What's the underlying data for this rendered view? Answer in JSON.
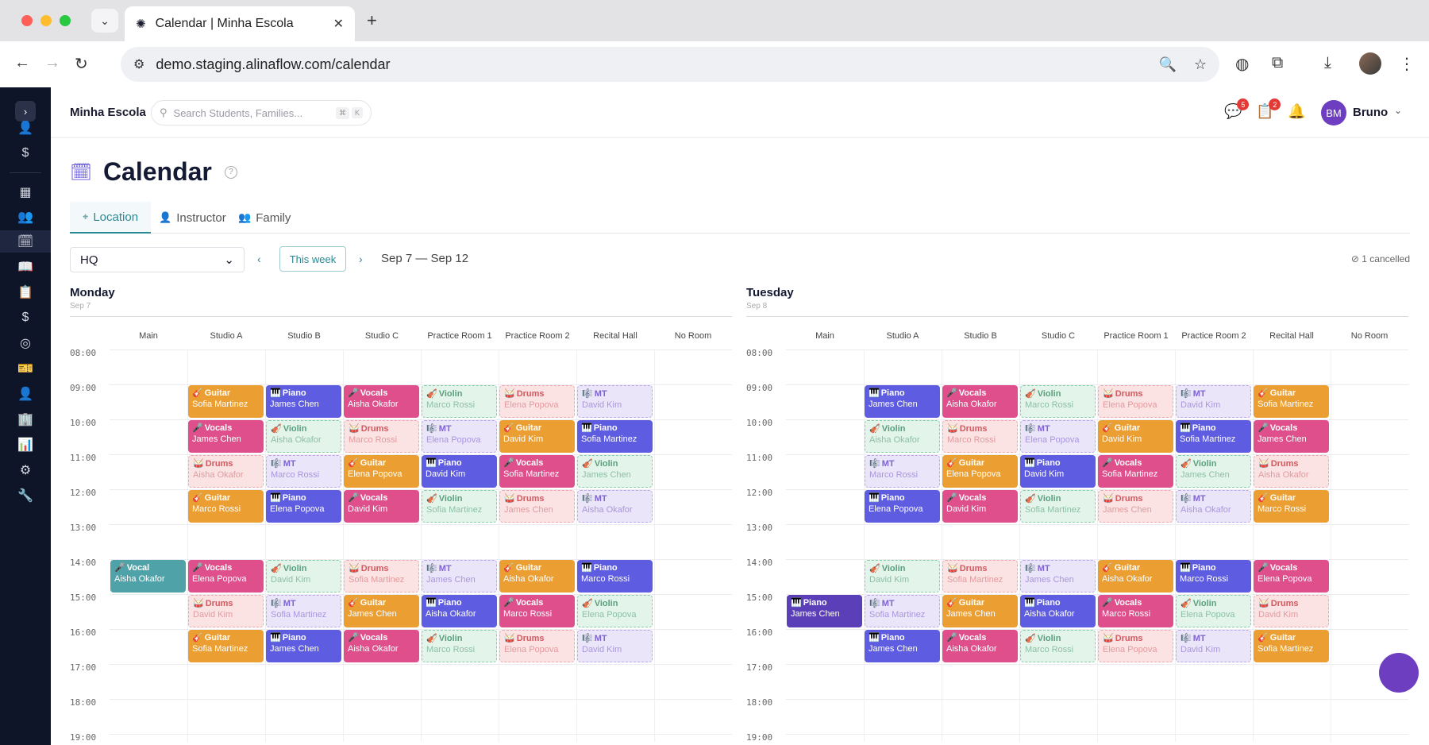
{
  "browser": {
    "tab_title": "Calendar | Minha Escola",
    "url": "demo.staging.alinaflow.com/calendar"
  },
  "header": {
    "school": "Minha Escola",
    "search_placeholder": "Search Students, Families...",
    "kbd1": "⌘",
    "kbd2": "K",
    "messages_badge": "5",
    "tasks_badge": "2",
    "user_initials": "BM",
    "user_name": "Bruno"
  },
  "page": {
    "title": "Calendar",
    "tabs": [
      "Location",
      "Instructor",
      "Family"
    ],
    "location": "HQ",
    "this_week": "This week",
    "range": "Sep 7 — Sep 12",
    "cancelled": "1 cancelled"
  },
  "colors": {
    "accent": "#2a8a93",
    "sidebar": "#0e1528",
    "brand": "#6d3fc0"
  },
  "rooms": [
    "Main",
    "Studio A",
    "Studio B",
    "Studio C",
    "Practice Room 1",
    "Practice Room 2",
    "Recital Hall",
    "No Room"
  ],
  "times": [
    "08:00",
    "09:00",
    "10:00",
    "11:00",
    "12:00",
    "13:00",
    "14:00",
    "15:00",
    "16:00",
    "17:00",
    "18:00",
    "19:00"
  ],
  "days": [
    {
      "name": "Monday",
      "date": "Sep 7",
      "events": [
        {
          "room": 1,
          "slot": 1,
          "title": "Guitar",
          "who": "Sofia Martinez",
          "kind": "guitar",
          "icon": "🎸"
        },
        {
          "room": 2,
          "slot": 1,
          "title": "Piano",
          "who": "James Chen",
          "kind": "piano",
          "icon": "🎹"
        },
        {
          "room": 3,
          "slot": 1,
          "title": "Vocals",
          "who": "Aisha Okafor",
          "kind": "vocals",
          "icon": "🎤"
        },
        {
          "room": 4,
          "slot": 1,
          "title": "Violin",
          "who": "Marco Rossi",
          "kind": "violin",
          "icon": "🎻"
        },
        {
          "room": 5,
          "slot": 1,
          "title": "Drums",
          "who": "Elena Popova",
          "kind": "drums",
          "icon": "🥁"
        },
        {
          "room": 6,
          "slot": 1,
          "title": "MT",
          "who": "David Kim",
          "kind": "mt",
          "icon": "🎼"
        },
        {
          "room": 1,
          "slot": 2,
          "title": "Vocals",
          "who": "James Chen",
          "kind": "vocals",
          "icon": "🎤"
        },
        {
          "room": 2,
          "slot": 2,
          "title": "Violin",
          "who": "Aisha Okafor",
          "kind": "violin",
          "icon": "🎻"
        },
        {
          "room": 3,
          "slot": 2,
          "title": "Drums",
          "who": "Marco Rossi",
          "kind": "drums",
          "icon": "🥁"
        },
        {
          "room": 4,
          "slot": 2,
          "title": "MT",
          "who": "Elena Popova",
          "kind": "mt",
          "icon": "🎼"
        },
        {
          "room": 5,
          "slot": 2,
          "title": "Guitar",
          "who": "David Kim",
          "kind": "guitar",
          "icon": "🎸"
        },
        {
          "room": 6,
          "slot": 2,
          "title": "Piano",
          "who": "Sofia Martinez",
          "kind": "piano",
          "icon": "🎹"
        },
        {
          "room": 1,
          "slot": 3,
          "title": "Drums",
          "who": "Aisha Okafor",
          "kind": "drums",
          "icon": "🥁"
        },
        {
          "room": 2,
          "slot": 3,
          "title": "MT",
          "who": "Marco Rossi",
          "kind": "mt",
          "icon": "🎼"
        },
        {
          "room": 3,
          "slot": 3,
          "title": "Guitar",
          "who": "Elena Popova",
          "kind": "guitar",
          "icon": "🎸"
        },
        {
          "room": 4,
          "slot": 3,
          "title": "Piano",
          "who": "David Kim",
          "kind": "piano",
          "icon": "🎹"
        },
        {
          "room": 5,
          "slot": 3,
          "title": "Vocals",
          "who": "Sofia Martinez",
          "kind": "vocals",
          "icon": "🎤"
        },
        {
          "room": 6,
          "slot": 3,
          "title": "Violin",
          "who": "James Chen",
          "kind": "violin",
          "icon": "🎻"
        },
        {
          "room": 1,
          "slot": 4,
          "title": "Guitar",
          "who": "Marco Rossi",
          "kind": "guitar",
          "icon": "🎸"
        },
        {
          "room": 2,
          "slot": 4,
          "title": "Piano",
          "who": "Elena Popova",
          "kind": "piano",
          "icon": "🎹"
        },
        {
          "room": 3,
          "slot": 4,
          "title": "Vocals",
          "who": "David Kim",
          "kind": "vocals",
          "icon": "🎤"
        },
        {
          "room": 4,
          "slot": 4,
          "title": "Violin",
          "who": "Sofia Martinez",
          "kind": "violin",
          "icon": "🎻"
        },
        {
          "room": 5,
          "slot": 4,
          "title": "Drums",
          "who": "James Chen",
          "kind": "drums",
          "icon": "🥁"
        },
        {
          "room": 6,
          "slot": 4,
          "title": "MT",
          "who": "Aisha Okafor",
          "kind": "mt",
          "icon": "🎼"
        },
        {
          "room": 0,
          "slot": 6,
          "title": "Vocal",
          "who": "Aisha Okafor",
          "kind": "vocal",
          "icon": "🎤"
        },
        {
          "room": 1,
          "slot": 6,
          "title": "Vocals",
          "who": "Elena Popova",
          "kind": "vocals",
          "icon": "🎤"
        },
        {
          "room": 2,
          "slot": 6,
          "title": "Violin",
          "who": "David Kim",
          "kind": "violin",
          "icon": "🎻"
        },
        {
          "room": 3,
          "slot": 6,
          "title": "Drums",
          "who": "Sofia Martinez",
          "kind": "drums",
          "icon": "🥁"
        },
        {
          "room": 4,
          "slot": 6,
          "title": "MT",
          "who": "James Chen",
          "kind": "mt",
          "icon": "🎼"
        },
        {
          "room": 5,
          "slot": 6,
          "title": "Guitar",
          "who": "Aisha Okafor",
          "kind": "guitar",
          "icon": "🎸"
        },
        {
          "room": 6,
          "slot": 6,
          "title": "Piano",
          "who": "Marco Rossi",
          "kind": "piano",
          "icon": "🎹"
        },
        {
          "room": 1,
          "slot": 7,
          "title": "Drums",
          "who": "David Kim",
          "kind": "drums",
          "icon": "🥁"
        },
        {
          "room": 2,
          "slot": 7,
          "title": "MT",
          "who": "Sofia Martinez",
          "kind": "mt",
          "icon": "🎼"
        },
        {
          "room": 3,
          "slot": 7,
          "title": "Guitar",
          "who": "James Chen",
          "kind": "guitar",
          "icon": "🎸"
        },
        {
          "room": 4,
          "slot": 7,
          "title": "Piano",
          "who": "Aisha Okafor",
          "kind": "piano",
          "icon": "🎹"
        },
        {
          "room": 5,
          "slot": 7,
          "title": "Vocals",
          "who": "Marco Rossi",
          "kind": "vocals",
          "icon": "🎤"
        },
        {
          "room": 6,
          "slot": 7,
          "title": "Violin",
          "who": "Elena Popova",
          "kind": "violin",
          "icon": "🎻"
        },
        {
          "room": 1,
          "slot": 8,
          "title": "Guitar",
          "who": "Sofia Martinez",
          "kind": "guitar",
          "icon": "🎸"
        },
        {
          "room": 2,
          "slot": 8,
          "title": "Piano",
          "who": "James Chen",
          "kind": "piano",
          "icon": "🎹"
        },
        {
          "room": 3,
          "slot": 8,
          "title": "Vocals",
          "who": "Aisha Okafor",
          "kind": "vocals",
          "icon": "🎤"
        },
        {
          "room": 4,
          "slot": 8,
          "title": "Violin",
          "who": "Marco Rossi",
          "kind": "violin",
          "icon": "🎻"
        },
        {
          "room": 5,
          "slot": 8,
          "title": "Drums",
          "who": "Elena Popova",
          "kind": "drums",
          "icon": "🥁"
        },
        {
          "room": 6,
          "slot": 8,
          "title": "MT",
          "who": "David Kim",
          "kind": "mt",
          "icon": "🎼"
        }
      ]
    },
    {
      "name": "Tuesday",
      "date": "Sep 8",
      "events": [
        {
          "room": 1,
          "slot": 1,
          "title": "Piano",
          "who": "James Chen",
          "kind": "piano",
          "icon": "🎹"
        },
        {
          "room": 2,
          "slot": 1,
          "title": "Vocals",
          "who": "Aisha Okafor",
          "kind": "vocals",
          "icon": "🎤"
        },
        {
          "room": 3,
          "slot": 1,
          "title": "Violin",
          "who": "Marco Rossi",
          "kind": "violin",
          "icon": "🎻"
        },
        {
          "room": 4,
          "slot": 1,
          "title": "Drums",
          "who": "Elena Popova",
          "kind": "drums",
          "icon": "🥁"
        },
        {
          "room": 5,
          "slot": 1,
          "title": "MT",
          "who": "David Kim",
          "kind": "mt",
          "icon": "🎼"
        },
        {
          "room": 6,
          "slot": 1,
          "title": "Guitar",
          "who": "Sofia Martinez",
          "kind": "guitar",
          "icon": "🎸"
        },
        {
          "room": 1,
          "slot": 2,
          "title": "Violin",
          "who": "Aisha Okafor",
          "kind": "violin",
          "icon": "🎻"
        },
        {
          "room": 2,
          "slot": 2,
          "title": "Drums",
          "who": "Marco Rossi",
          "kind": "drums",
          "icon": "🥁"
        },
        {
          "room": 3,
          "slot": 2,
          "title": "MT",
          "who": "Elena Popova",
          "kind": "mt",
          "icon": "🎼"
        },
        {
          "room": 4,
          "slot": 2,
          "title": "Guitar",
          "who": "David Kim",
          "kind": "guitar",
          "icon": "🎸"
        },
        {
          "room": 5,
          "slot": 2,
          "title": "Piano",
          "who": "Sofia Martinez",
          "kind": "piano",
          "icon": "🎹"
        },
        {
          "room": 6,
          "slot": 2,
          "title": "Vocals",
          "who": "James Chen",
          "kind": "vocals",
          "icon": "🎤"
        },
        {
          "room": 1,
          "slot": 3,
          "title": "MT",
          "who": "Marco Rossi",
          "kind": "mt",
          "icon": "🎼"
        },
        {
          "room": 2,
          "slot": 3,
          "title": "Guitar",
          "who": "Elena Popova",
          "kind": "guitar",
          "icon": "🎸"
        },
        {
          "room": 3,
          "slot": 3,
          "title": "Piano",
          "who": "David Kim",
          "kind": "piano",
          "icon": "🎹"
        },
        {
          "room": 4,
          "slot": 3,
          "title": "Vocals",
          "who": "Sofia Martinez",
          "kind": "vocals",
          "icon": "🎤"
        },
        {
          "room": 5,
          "slot": 3,
          "title": "Violin",
          "who": "James Chen",
          "kind": "violin",
          "icon": "🎻"
        },
        {
          "room": 6,
          "slot": 3,
          "title": "Drums",
          "who": "Aisha Okafor",
          "kind": "drums",
          "icon": "🥁"
        },
        {
          "room": 1,
          "slot": 4,
          "title": "Piano",
          "who": "Elena Popova",
          "kind": "piano",
          "icon": "🎹"
        },
        {
          "room": 2,
          "slot": 4,
          "title": "Vocals",
          "who": "David Kim",
          "kind": "vocals",
          "icon": "🎤"
        },
        {
          "room": 3,
          "slot": 4,
          "title": "Violin",
          "who": "Sofia Martinez",
          "kind": "violin",
          "icon": "🎻"
        },
        {
          "room": 4,
          "slot": 4,
          "title": "Drums",
          "who": "James Chen",
          "kind": "drums",
          "icon": "🥁"
        },
        {
          "room": 5,
          "slot": 4,
          "title": "MT",
          "who": "Aisha Okafor",
          "kind": "mt",
          "icon": "🎼"
        },
        {
          "room": 6,
          "slot": 4,
          "title": "Guitar",
          "who": "Marco Rossi",
          "kind": "guitar",
          "icon": "🎸"
        },
        {
          "room": 1,
          "slot": 6,
          "title": "Violin",
          "who": "David Kim",
          "kind": "violin",
          "icon": "🎻"
        },
        {
          "room": 2,
          "slot": 6,
          "title": "Drums",
          "who": "Sofia Martinez",
          "kind": "drums",
          "icon": "🥁"
        },
        {
          "room": 3,
          "slot": 6,
          "title": "MT",
          "who": "James Chen",
          "kind": "mt",
          "icon": "🎼"
        },
        {
          "room": 4,
          "slot": 6,
          "title": "Guitar",
          "who": "Aisha Okafor",
          "kind": "guitar",
          "icon": "🎸"
        },
        {
          "room": 5,
          "slot": 6,
          "title": "Piano",
          "who": "Marco Rossi",
          "kind": "piano",
          "icon": "🎹"
        },
        {
          "room": 6,
          "slot": 6,
          "title": "Vocals",
          "who": "Elena Popova",
          "kind": "vocals",
          "icon": "🎤"
        },
        {
          "room": 0,
          "slot": 7,
          "title": "Piano",
          "who": "James Chen",
          "kind": "pianopurple",
          "icon": "🎹"
        },
        {
          "room": 1,
          "slot": 7,
          "title": "MT",
          "who": "Sofia Martinez",
          "kind": "mt",
          "icon": "🎼"
        },
        {
          "room": 2,
          "slot": 7,
          "title": "Guitar",
          "who": "James Chen",
          "kind": "guitar",
          "icon": "🎸"
        },
        {
          "room": 3,
          "slot": 7,
          "title": "Piano",
          "who": "Aisha Okafor",
          "kind": "piano",
          "icon": "🎹"
        },
        {
          "room": 4,
          "slot": 7,
          "title": "Vocals",
          "who": "Marco Rossi",
          "kind": "vocals",
          "icon": "🎤"
        },
        {
          "room": 5,
          "slot": 7,
          "title": "Violin",
          "who": "Elena Popova",
          "kind": "violin",
          "icon": "🎻"
        },
        {
          "room": 6,
          "slot": 7,
          "title": "Drums",
          "who": "David Kim",
          "kind": "drums",
          "icon": "🥁"
        },
        {
          "room": 1,
          "slot": 8,
          "title": "Piano",
          "who": "James Chen",
          "kind": "piano",
          "icon": "🎹"
        },
        {
          "room": 2,
          "slot": 8,
          "title": "Vocals",
          "who": "Aisha Okafor",
          "kind": "vocals",
          "icon": "🎤"
        },
        {
          "room": 3,
          "slot": 8,
          "title": "Violin",
          "who": "Marco Rossi",
          "kind": "violin",
          "icon": "🎻"
        },
        {
          "room": 4,
          "slot": 8,
          "title": "Drums",
          "who": "Elena Popova",
          "kind": "drums",
          "icon": "🥁"
        },
        {
          "room": 5,
          "slot": 8,
          "title": "MT",
          "who": "David Kim",
          "kind": "mt",
          "icon": "🎼"
        },
        {
          "room": 6,
          "slot": 8,
          "title": "Guitar",
          "who": "Sofia Martinez",
          "kind": "guitar",
          "icon": "🎸"
        }
      ]
    }
  ]
}
